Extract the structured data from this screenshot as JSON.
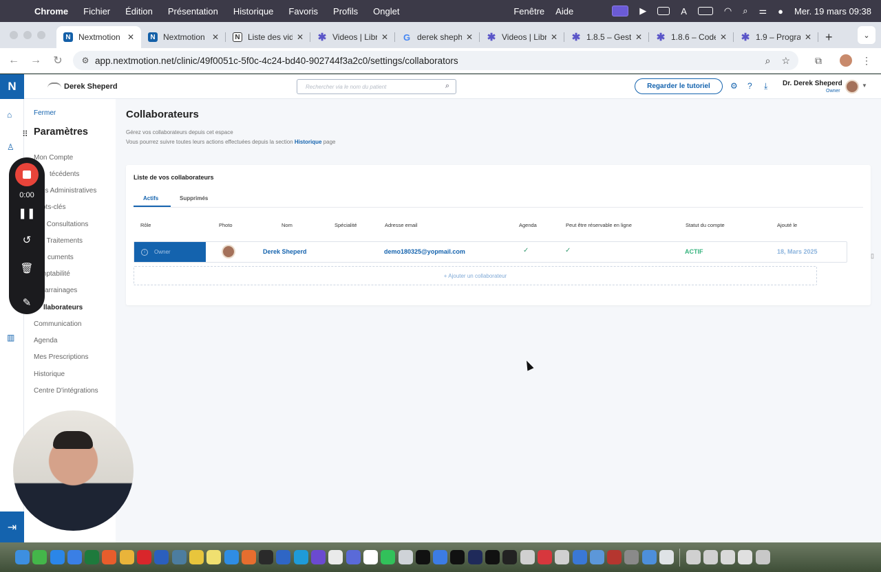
{
  "menubar": {
    "app": "Chrome",
    "items": [
      "Fichier",
      "Édition",
      "Présentation",
      "Historique",
      "Favoris",
      "Profils",
      "Onglet"
    ],
    "right_items": [
      "Fenêtre",
      "Aide"
    ],
    "clock": "Mer. 19 mars  09:38"
  },
  "browser": {
    "tabs": [
      {
        "label": "Nextmotion",
        "icon": "nextmotion-icon",
        "active": true
      },
      {
        "label": "Nextmotion",
        "icon": "nextmotion-icon"
      },
      {
        "label": "Liste des vid",
        "icon": "notion-icon"
      },
      {
        "label": "Videos | Libr",
        "icon": "star-icon"
      },
      {
        "label": "derek sheph",
        "icon": "google-icon"
      },
      {
        "label": "Videos | Libr",
        "icon": "star-icon"
      },
      {
        "label": "1.8.5 – Gest",
        "icon": "star-icon"
      },
      {
        "label": "1.8.6 – Code",
        "icon": "star-icon"
      },
      {
        "label": "1.9 – Progra",
        "icon": "star-icon"
      }
    ],
    "url": "app.nextmotion.net/clinic/49f0051c-5f0c-4c24-bd40-902744f3a2c0/settings/collaborators"
  },
  "app": {
    "brand_letter": "N",
    "clinic_name": "Derek Sheperd",
    "search_placeholder": "Rechercher via le nom du patient",
    "tutorial_button": "Regarder le tutoriel",
    "user_name": "Dr. Derek Sheperd",
    "user_role": "Owner"
  },
  "settings_nav": {
    "close": "Fermer",
    "title": "Paramètres",
    "items": [
      "Mon Compte",
      "Antécédents",
      "Infos Administratives",
      "Mots-clés",
      "Mes Consultations",
      "Mes Traitements",
      "Documents",
      "Comptabilité",
      "Parrainages",
      "Collaborateurs",
      "Communication",
      "Agenda",
      "Mes Prescriptions",
      "Historique",
      "Centre D'intégrations"
    ],
    "visible_items": [
      "Mon Compte",
      "técédents",
      "fos Administratives",
      "ots-clés",
      "s Consultations",
      "s Traitements",
      "cuments",
      "mptabilité",
      "arrainages",
      "llaborateurs",
      "Communication",
      "Agenda",
      "Mes Prescriptions",
      "Historique",
      "Centre D'intégrations"
    ],
    "active": "Collaborateurs"
  },
  "page": {
    "title": "Collaborateurs",
    "desc1": "Gérez vos collaborateurs depuis cet espace",
    "desc2_pre": "Vous pourrez suivre toutes leurs actions effectuées depuis la section",
    "desc2_link": "Historique",
    "desc2_post": "page",
    "card_title": "Liste de vos collaborateurs",
    "tabs": [
      "Actifs",
      "Supprimés"
    ],
    "columns": [
      "Rôle",
      "Photo",
      "Nom",
      "Spécialité",
      "Adresse email",
      "Agenda",
      "Peut être réservable en ligne",
      "Statut du compte",
      "Ajouté le"
    ],
    "rows": [
      {
        "role": "Owner",
        "nom": "Derek Sheperd",
        "specialite": "",
        "email": "demo180325@yopmail.com",
        "agenda": "✓",
        "reservable": "✓",
        "statut": "ACTIF",
        "ajoute": "18, Mars 2025"
      }
    ],
    "add_button": "+ Ajouter un collaborateur"
  },
  "recorder": {
    "time": "0:00"
  }
}
